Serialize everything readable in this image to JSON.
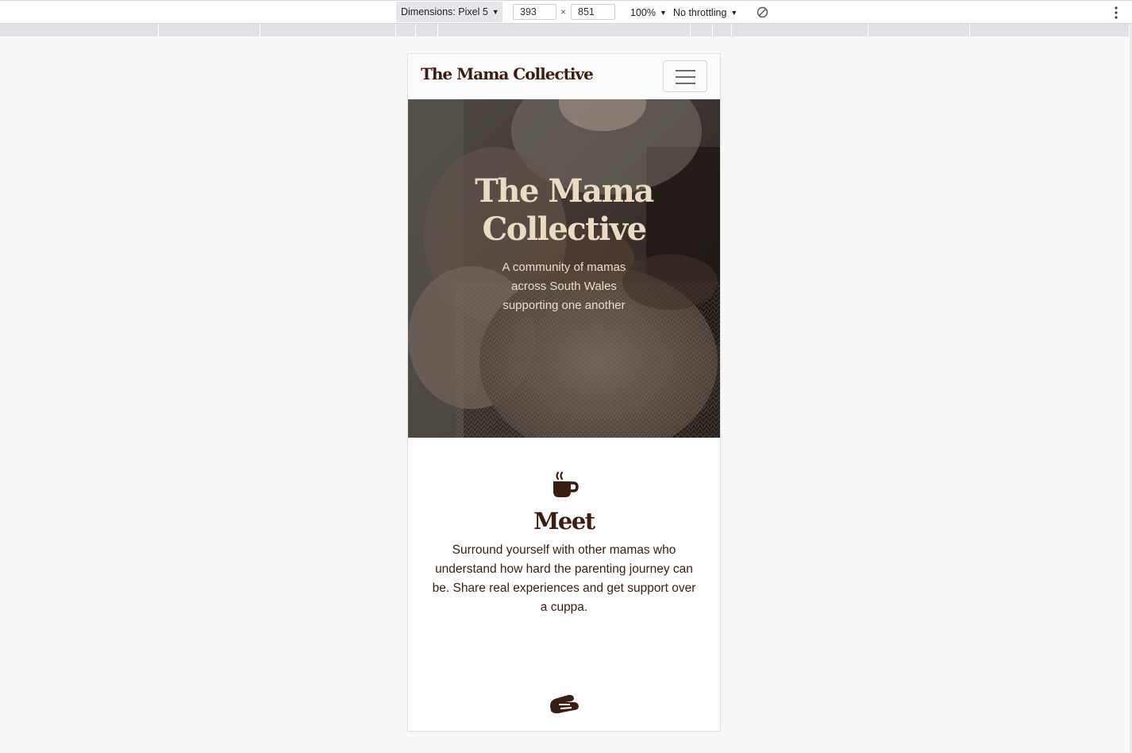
{
  "devtools": {
    "device_label": "Dimensions: Pixel 5",
    "width_value": "393",
    "times_sign": "×",
    "height_value": "851",
    "zoom_label": "100%",
    "throttle_label": "No throttling",
    "icons": {
      "dropdown": "caret-down-icon",
      "rotate": "rotate-icon",
      "more": "more-vertical-icon"
    }
  },
  "site": {
    "brand": "The Mama Collective",
    "menu_icon": "hamburger-icon",
    "hero": {
      "title": "The Mama Collective",
      "subtitle": "A community of mamas across South Wales supporting one another"
    },
    "features": [
      {
        "icon": "coffee-mug-icon",
        "title": "Meet",
        "text": "Surround yourself with other mamas who understand how hard the parenting journey can be. Share real experiences and get support over a cuppa."
      },
      {
        "icon": "handshake-icon"
      }
    ]
  },
  "colors": {
    "brand_dark": "#3b1d11",
    "hero_text": "#eadcc4",
    "page_background": "#f7f8f8",
    "navbar_background": "#fbfbfb"
  }
}
